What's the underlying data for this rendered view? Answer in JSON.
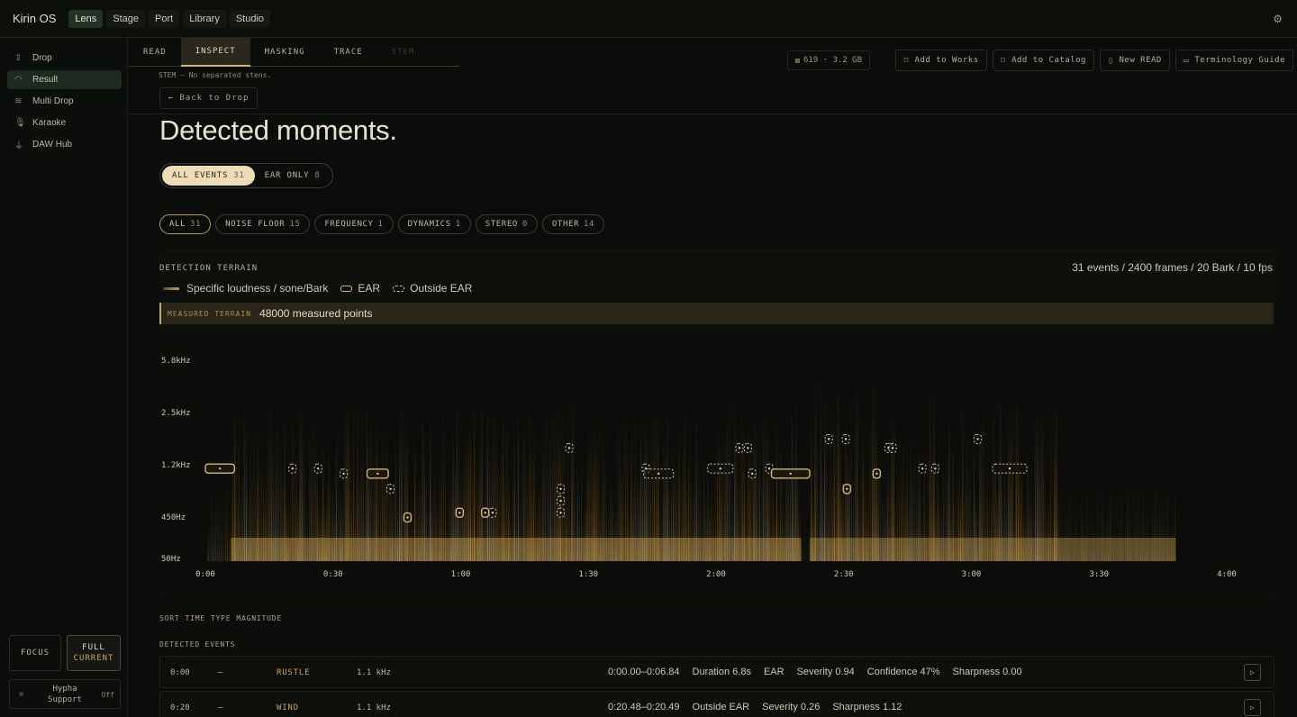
{
  "app": {
    "title": "Kirin OS",
    "settings_icon": "gear-icon"
  },
  "topnav": [
    {
      "label": "Lens",
      "active": true
    },
    {
      "label": "Stage"
    },
    {
      "label": "Port"
    },
    {
      "label": "Library"
    },
    {
      "label": "Studio"
    }
  ],
  "sidebar": {
    "items": [
      {
        "label": "Drop",
        "icon": "upload-icon"
      },
      {
        "label": "Result",
        "icon": "gauge-icon",
        "active": true
      },
      {
        "label": "Multi Drop",
        "icon": "layers-icon"
      },
      {
        "label": "Karaoke",
        "icon": "mic-icon"
      },
      {
        "label": "DAW Hub",
        "icon": "plug-icon"
      }
    ],
    "mode_focus": "FOCUS",
    "mode_full_1": "FULL",
    "mode_full_2": "CURRENT",
    "hypha_1": "Hypha",
    "hypha_2": "Support",
    "hypha_state": "Off"
  },
  "subtabs": [
    {
      "label": "READ"
    },
    {
      "label": "INSPECT",
      "active": true
    },
    {
      "label": "MASKING"
    },
    {
      "label": "TRACE"
    },
    {
      "label": "STEM",
      "disabled": true
    }
  ],
  "stem_note": "STEM — No separated stens.",
  "back_label": "Back to Drop",
  "storage": "619 · 3.2 GB",
  "actions": [
    {
      "label": "Add to Works",
      "icon": "bookmark-icon"
    },
    {
      "label": "Add to Catalog",
      "icon": "bookmark-icon"
    },
    {
      "label": "New READ",
      "icon": "file-icon"
    },
    {
      "label": "Terminology Guide",
      "icon": "book-icon"
    }
  ],
  "page_title": "Detected moments.",
  "segment": [
    {
      "label": "ALL EVENTS",
      "count": "31",
      "active": true
    },
    {
      "label": "EAR ONLY",
      "count": "8"
    }
  ],
  "filters": [
    {
      "label": "ALL",
      "count": "31",
      "active": true
    },
    {
      "label": "NOISE FLOOR",
      "count": "15"
    },
    {
      "label": "FREQUENCY",
      "count": "1"
    },
    {
      "label": "DYNAMICS",
      "count": "1"
    },
    {
      "label": "STEREO",
      "count": "0"
    },
    {
      "label": "OTHER",
      "count": "14"
    }
  ],
  "terrain": {
    "label": "DETECTION TERRAIN",
    "summary": "31 events / 2400 frames / 20 Bark / 10 fps",
    "legend_loudness": "Specific loudness / sone/Bark",
    "legend_ear": "EAR",
    "legend_outside": "Outside EAR",
    "measured_key": "MEASURED TERRAIN",
    "measured_value": "48000 measured points"
  },
  "colors": {
    "accent": "#c9a55e",
    "accent_light": "#ecdcb7",
    "bg": "#0b0d0a"
  },
  "chart_data": {
    "type": "heatmap",
    "x_ticks": [
      "0:00",
      "0:30",
      "1:00",
      "1:30",
      "2:00",
      "2:30",
      "3:00",
      "3:30",
      "4:00"
    ],
    "x_range_s": [
      0,
      240
    ],
    "y_ticks": [
      "5.8kHz",
      "2.5kHz",
      "1.2kHz",
      "450Hz",
      "50Hz"
    ],
    "ear_events": [
      {
        "start_s": 0.0,
        "end_s": 6.84,
        "freq": "1.1 kHz"
      },
      {
        "start_s": 38,
        "end_s": 43,
        "freq": "1.0 kHz"
      },
      {
        "start_s": 133,
        "end_s": 142,
        "freq": "1.0 kHz"
      },
      {
        "start_s": 59,
        "end_s": 60.5,
        "freq": "480 Hz"
      },
      {
        "start_s": 65,
        "end_s": 66.5,
        "freq": "480 Hz"
      },
      {
        "start_s": 47,
        "end_s": 48,
        "freq": "420 Hz"
      },
      {
        "start_s": 150,
        "end_s": 151.5,
        "freq": "750 Hz"
      },
      {
        "start_s": 157,
        "end_s": 158.5,
        "freq": "1.0 kHz"
      }
    ],
    "outside_events": [
      {
        "start_s": 20.48,
        "end_s": 20.49,
        "freq": "1.1 kHz"
      },
      {
        "start_s": 26,
        "end_s": 27,
        "freq": "1.1 kHz"
      },
      {
        "start_s": 32,
        "end_s": 33,
        "freq": "1.0 kHz"
      },
      {
        "start_s": 43,
        "end_s": 44,
        "freq": "750 Hz"
      },
      {
        "start_s": 67,
        "end_s": 68,
        "freq": "480 Hz"
      },
      {
        "start_s": 83,
        "end_s": 84,
        "freq": "750 Hz"
      },
      {
        "start_s": 83,
        "end_s": 84,
        "freq": "600 Hz"
      },
      {
        "start_s": 83,
        "end_s": 84,
        "freq": "480 Hz"
      },
      {
        "start_s": 85,
        "end_s": 86,
        "freq": "1.5 kHz"
      },
      {
        "start_s": 103,
        "end_s": 104,
        "freq": "1.1 kHz"
      },
      {
        "start_s": 103,
        "end_s": 110,
        "freq": "1.0 kHz"
      },
      {
        "start_s": 118,
        "end_s": 124,
        "freq": "1.1 kHz"
      },
      {
        "start_s": 125,
        "end_s": 126,
        "freq": "1.5 kHz"
      },
      {
        "start_s": 127,
        "end_s": 128,
        "freq": "1.5 kHz"
      },
      {
        "start_s": 128,
        "end_s": 129,
        "freq": "1.0 kHz"
      },
      {
        "start_s": 132,
        "end_s": 133,
        "freq": "1.1 kHz"
      },
      {
        "start_s": 146,
        "end_s": 147,
        "freq": "1.7 kHz"
      },
      {
        "start_s": 150,
        "end_s": 151,
        "freq": "1.7 kHz"
      },
      {
        "start_s": 160,
        "end_s": 161,
        "freq": "1.5 kHz"
      },
      {
        "start_s": 161,
        "end_s": 162,
        "freq": "1.5 kHz"
      },
      {
        "start_s": 168,
        "end_s": 169,
        "freq": "1.1 kHz"
      },
      {
        "start_s": 171,
        "end_s": 172,
        "freq": "1.1 kHz"
      },
      {
        "start_s": 181,
        "end_s": 182,
        "freq": "1.7 kHz"
      },
      {
        "start_s": 185,
        "end_s": 193,
        "freq": "1.1 kHz"
      }
    ]
  },
  "sort": {
    "label": "SORT",
    "options": [
      "TIME",
      "TYPE",
      "MAGNITUDE"
    ],
    "active": "TIME"
  },
  "events_label": "DETECTED EVENTS",
  "events": [
    {
      "time": "0:00",
      "dash": "—",
      "type": "RUSTLE",
      "freq": "1.1 kHz",
      "range": "0:00.00–0:06.84",
      "meta": [
        "Duration 6.8s",
        "EAR",
        "Severity 0.94",
        "Confidence 47%",
        "Sharpness 0.00"
      ]
    },
    {
      "time": "0:20",
      "dash": "—",
      "type": "WIND",
      "freq": "1.1 kHz",
      "range": "0:20.48–0:20.49",
      "meta": [
        "Outside EAR",
        "Severity 0.26",
        "Sharpness 1.12"
      ]
    }
  ]
}
